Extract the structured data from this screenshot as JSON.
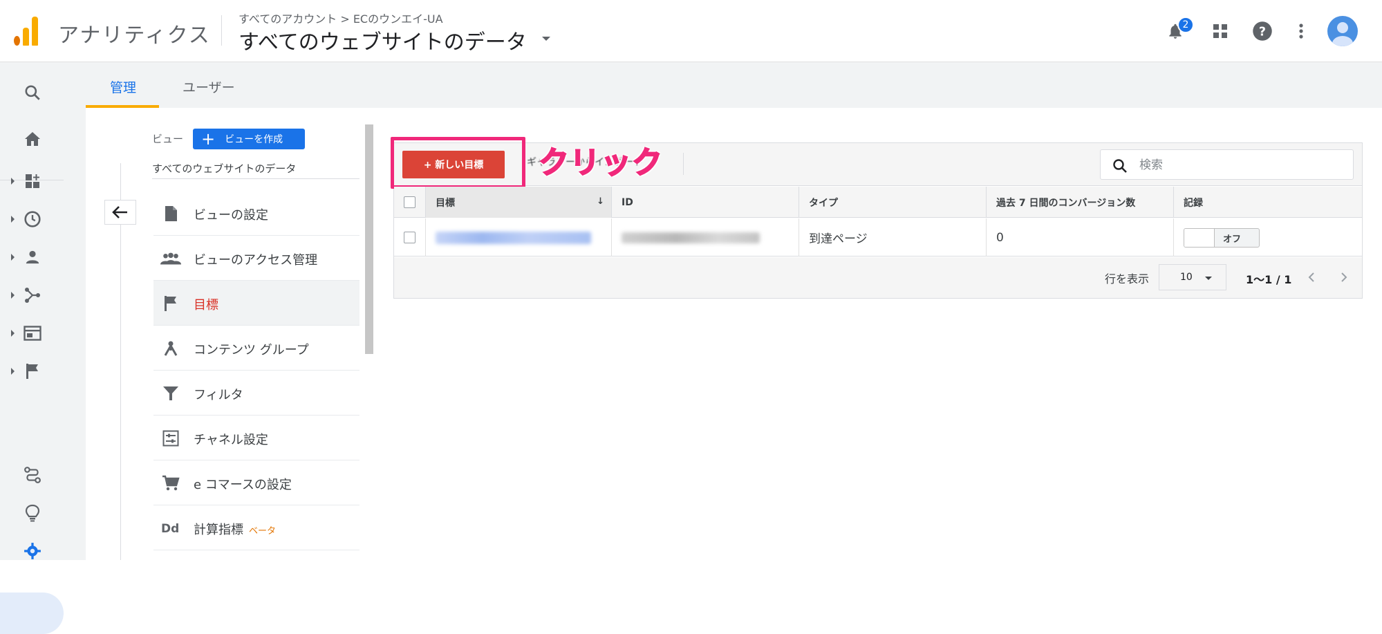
{
  "header": {
    "app_title": "アナリティクス",
    "breadcrumb": "すべてのアカウント > ECのウンエイ-UA",
    "view_selector": "すべてのウェブサイトのデータ",
    "notification_count": "2"
  },
  "left_nav": {
    "icons": [
      "search-icon",
      "home-icon",
      "customization-icon",
      "realtime-icon",
      "audience-icon",
      "acquisition-icon",
      "behavior-icon",
      "conversions-icon",
      "attribution-icon",
      "insights-icon",
      "admin-gear-icon"
    ]
  },
  "tabs": [
    {
      "label": "管理",
      "active": true
    },
    {
      "label": "ユーザー",
      "active": false
    }
  ],
  "view_column": {
    "view_label": "ビュー",
    "create_view_label": "ビューを作成",
    "view_name": "すべてのウェブサイトのデータ",
    "menu": [
      {
        "label": "ビューの設定",
        "icon": "document-icon"
      },
      {
        "label": "ビューのアクセス管理",
        "icon": "people-icon"
      },
      {
        "label": "目標",
        "icon": "flag-icon",
        "selected": true
      },
      {
        "label": "コンテンツ グループ",
        "icon": "content-group-icon"
      },
      {
        "label": "フィルタ",
        "icon": "filter-icon"
      },
      {
        "label": "チャネル設定",
        "icon": "channel-settings-icon"
      },
      {
        "label": "e コマースの設定",
        "icon": "cart-icon"
      },
      {
        "label": "計算指標",
        "icon": "dd-icon",
        "badge": "ベータ"
      }
    ]
  },
  "goals": {
    "new_goal_label": "+ 新しい目標",
    "import_label": "ギャラリーからインポート",
    "annotation": "クリック",
    "search_placeholder": "検索",
    "columns": [
      "目標",
      "ID",
      "タイプ",
      "過去 7 日間のコンバージョン数",
      "記録"
    ],
    "rows": [
      {
        "type": "到達ページ",
        "conversions": "0",
        "recording": "オフ"
      }
    ],
    "rows_label": "行を表示",
    "rows_per_page": "10",
    "range": "1〜1 / 1"
  },
  "colors": {
    "accent": "#1a73e8",
    "new_goal_button": "#db4437",
    "annotation": "#f0287a",
    "tab_underline": "#f9ab00",
    "selected_item": "#d93025"
  }
}
